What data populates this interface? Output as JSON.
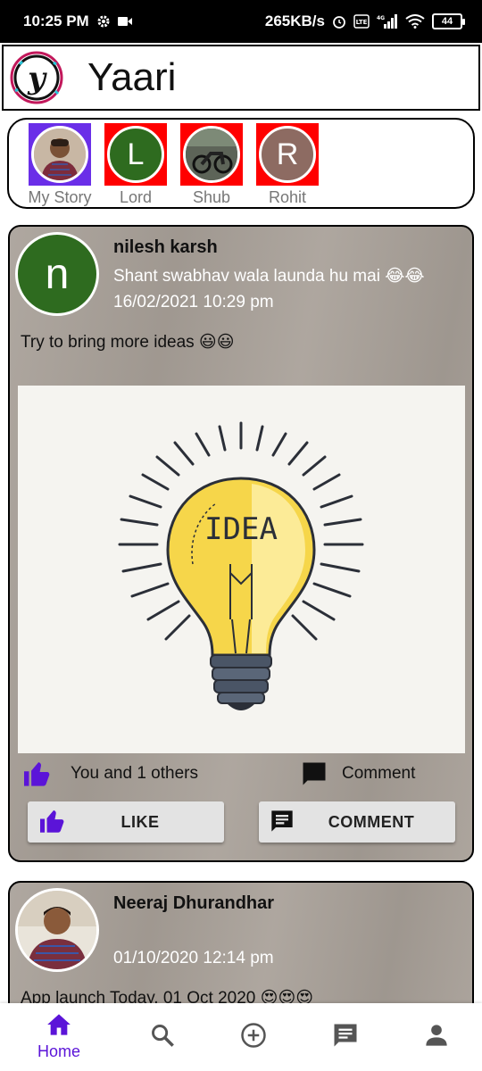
{
  "status_bar": {
    "time": "10:25 PM",
    "network_speed": "265KB/s",
    "battery": "44",
    "icons": [
      "gear-icon",
      "video-icon",
      "alarm-icon",
      "volte-icon",
      "signal-icon",
      "wifi-icon",
      "battery-icon"
    ]
  },
  "header": {
    "title": "Yaari",
    "logo_letter": "y"
  },
  "stories": [
    {
      "label": "My Story",
      "type": "photo",
      "frame_color": "#6a2ee8"
    },
    {
      "label": "Lord",
      "type": "letter",
      "letter": "L",
      "frame_color": "#ff0000",
      "circle_color": "#2e6b1f"
    },
    {
      "label": "Shub",
      "type": "photo",
      "frame_color": "#ff0000"
    },
    {
      "label": "Rohit",
      "type": "letter",
      "letter": "R",
      "frame_color": "#ff0000",
      "circle_color": "#8d6b62"
    }
  ],
  "posts": [
    {
      "author": "nilesh karsh",
      "avatar_letter": "n",
      "bio": "Shant swabhav wala launda hu mai 😂😂",
      "date": "16/02/2021 10:29 pm",
      "text": "Try to bring more ideas 😃😃",
      "image_text": "IDEA",
      "likes": "You and 1 others",
      "comment_label": "Comment",
      "like_button": "LIKE",
      "comment_button": "COMMENT"
    },
    {
      "author": "Neeraj Dhurandhar",
      "date": "01/10/2020 12:14 pm",
      "text": "App launch Today, 01 Oct 2020 😍😍😍"
    }
  ],
  "bottom_nav": {
    "home_label": "Home",
    "items": [
      "home-icon",
      "search-icon",
      "add-circle-icon",
      "chat-icon",
      "profile-icon"
    ]
  },
  "colors": {
    "accent": "#5b14d8",
    "post_bg": "#a8a098",
    "story_frame_red": "#ff0000",
    "story_frame_purple": "#6a2ee8"
  }
}
